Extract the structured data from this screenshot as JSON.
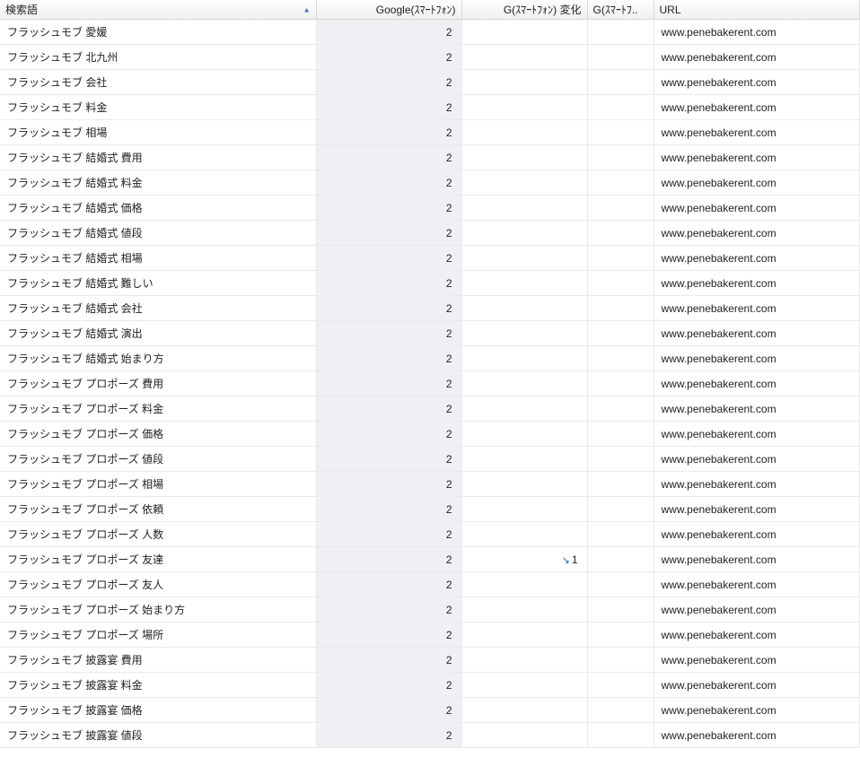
{
  "columns": {
    "term": "検索語",
    "g": "Google(ｽﾏｰﾄﾌｫﾝ)",
    "chg": "G(ｽﾏｰﾄﾌｫﾝ) 変化",
    "chg2": "G(ｽﾏｰﾄﾌ..",
    "url": "URL"
  },
  "sort_indicator": "▲",
  "change_down_icon": "↘",
  "rows": [
    {
      "term": "フラッシュモブ 愛媛",
      "rank": "2",
      "chg": "",
      "url": "www.penebakerent.com"
    },
    {
      "term": "フラッシュモブ 北九州",
      "rank": "2",
      "chg": "",
      "url": "www.penebakerent.com"
    },
    {
      "term": "フラッシュモブ 会社",
      "rank": "2",
      "chg": "",
      "url": "www.penebakerent.com"
    },
    {
      "term": "フラッシュモブ 料金",
      "rank": "2",
      "chg": "",
      "url": "www.penebakerent.com"
    },
    {
      "term": "フラッシュモブ 相場",
      "rank": "2",
      "chg": "",
      "url": "www.penebakerent.com"
    },
    {
      "term": "フラッシュモブ 結婚式 費用",
      "rank": "2",
      "chg": "",
      "url": "www.penebakerent.com"
    },
    {
      "term": "フラッシュモブ 結婚式 料金",
      "rank": "2",
      "chg": "",
      "url": "www.penebakerent.com"
    },
    {
      "term": "フラッシュモブ 結婚式 価格",
      "rank": "2",
      "chg": "",
      "url": "www.penebakerent.com"
    },
    {
      "term": "フラッシュモブ 結婚式 値段",
      "rank": "2",
      "chg": "",
      "url": "www.penebakerent.com"
    },
    {
      "term": "フラッシュモブ 結婚式 相場",
      "rank": "2",
      "chg": "",
      "url": "www.penebakerent.com"
    },
    {
      "term": "フラッシュモブ 結婚式 難しい",
      "rank": "2",
      "chg": "",
      "url": "www.penebakerent.com"
    },
    {
      "term": "フラッシュモブ 結婚式 会社",
      "rank": "2",
      "chg": "",
      "url": "www.penebakerent.com"
    },
    {
      "term": "フラッシュモブ 結婚式 演出",
      "rank": "2",
      "chg": "",
      "url": "www.penebakerent.com"
    },
    {
      "term": "フラッシュモブ 結婚式 始まり方",
      "rank": "2",
      "chg": "",
      "url": "www.penebakerent.com"
    },
    {
      "term": "フラッシュモブ プロポーズ 費用",
      "rank": "2",
      "chg": "",
      "url": "www.penebakerent.com"
    },
    {
      "term": "フラッシュモブ プロポーズ 料金",
      "rank": "2",
      "chg": "",
      "url": "www.penebakerent.com"
    },
    {
      "term": "フラッシュモブ プロポーズ 価格",
      "rank": "2",
      "chg": "",
      "url": "www.penebakerent.com"
    },
    {
      "term": "フラッシュモブ プロポーズ 値段",
      "rank": "2",
      "chg": "",
      "url": "www.penebakerent.com"
    },
    {
      "term": "フラッシュモブ プロポーズ 相場",
      "rank": "2",
      "chg": "",
      "url": "www.penebakerent.com"
    },
    {
      "term": "フラッシュモブ プロポーズ 依頼",
      "rank": "2",
      "chg": "",
      "url": "www.penebakerent.com"
    },
    {
      "term": "フラッシュモブ プロポーズ 人数",
      "rank": "2",
      "chg": "",
      "url": "www.penebakerent.com"
    },
    {
      "term": "フラッシュモブ プロポーズ 友達",
      "rank": "2",
      "chg": "1",
      "url": "www.penebakerent.com"
    },
    {
      "term": "フラッシュモブ プロポーズ 友人",
      "rank": "2",
      "chg": "",
      "url": "www.penebakerent.com"
    },
    {
      "term": "フラッシュモブ プロポーズ 始まり方",
      "rank": "2",
      "chg": "",
      "url": "www.penebakerent.com"
    },
    {
      "term": "フラッシュモブ プロポーズ 場所",
      "rank": "2",
      "chg": "",
      "url": "www.penebakerent.com"
    },
    {
      "term": "フラッシュモブ 披露宴 費用",
      "rank": "2",
      "chg": "",
      "url": "www.penebakerent.com"
    },
    {
      "term": "フラッシュモブ 披露宴 料金",
      "rank": "2",
      "chg": "",
      "url": "www.penebakerent.com"
    },
    {
      "term": "フラッシュモブ 披露宴 価格",
      "rank": "2",
      "chg": "",
      "url": "www.penebakerent.com"
    },
    {
      "term": "フラッシュモブ 披露宴 値段",
      "rank": "2",
      "chg": "",
      "url": "www.penebakerent.com"
    }
  ]
}
